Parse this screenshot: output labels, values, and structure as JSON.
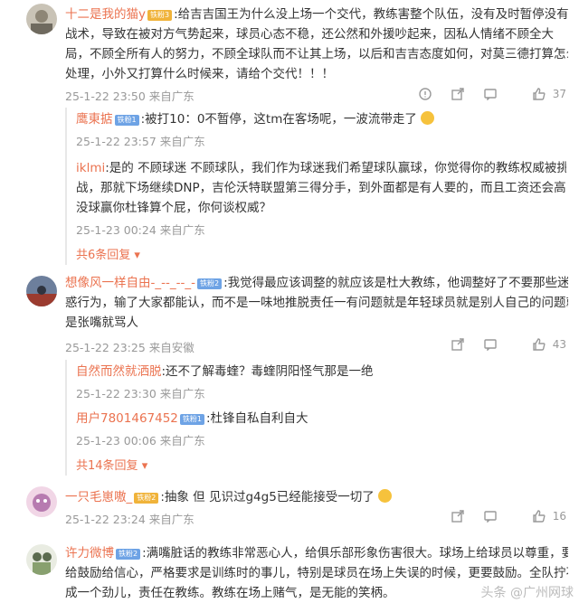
{
  "comments": [
    {
      "user": "十二是我的猫y",
      "badge": "铁粉3",
      "lines": [
        ":给吉吉国王为什么没上场一个交代，教练害整个队伍，没有及时暂停没有",
        "战术，导致在被对方气势起来，球员心态不稳，还公然和外援吵起来，因私人情绪不顾全大",
        "局，不顾全所有人的努力，不顾全球队而不让其上场，以后和吉吉态度如何，对莫三德打算怎么",
        "处理，小外又打算什么时候来，请给个交代！！！"
      ],
      "meta": "25-1-22 23:50 来自广东",
      "likes": "37",
      "replies": [
        {
          "user": "鹰東掂",
          "badge": "铁粉1",
          "text": ":被打10：0不暂停，这tm在客场呢，一波流带走了",
          "meta": "25-1-22 23:57 来自广东"
        },
        {
          "user": "iklmi",
          "lines": [
            ":是的 不顾球迷 不顾球队，我们作为球迷我们希望球队赢球，你觉得你的教练权威被挑",
            "战，那就下场继续DNP，吉伦沃特联盟第三得分手，到外面都是有人要的，而且工资还会高，",
            "没球赢你杜锋算个屁，你何谈权威？"
          ],
          "meta": "25-1-23 00:24 来自广东"
        }
      ],
      "more": "共6条回复"
    },
    {
      "user": "想像风一样自由-_--_--_-",
      "badge": "铁粉2",
      "lines": [
        ":我觉得最应该调整的就应该是杜大教练，他调整好了不要那些迷",
        "惑行为，输了大家都能认，而不是一味地推脱责任一有问题就是年轻球员就是别人自己的问题就",
        "是张嘴就骂人"
      ],
      "meta": "25-1-22 23:25 来自安徽",
      "likes": "43",
      "replies": [
        {
          "user": "自然而然就洒脱",
          "text": ":还不了解毒蝰？毒蝰阴阳怪气那是一绝",
          "meta": "25-1-22 23:30 来自广东"
        },
        {
          "user": "用户7801467452",
          "badge": "铁粉1",
          "text": ":杜锋自私自利自大",
          "meta": "25-1-23 00:06 来自广东"
        }
      ],
      "more": "共14条回复"
    },
    {
      "user": "一只毛崽嗷_",
      "badge": "铁粉2",
      "text": ":抽象 但 见识过g4g5已经能接受一切了",
      "meta": "25-1-22 23:24 来自广东",
      "likes": "16"
    },
    {
      "user": "许力微博",
      "badge": "铁粉2",
      "lines": [
        ":满嘴脏话的教练非常恶心人，给俱乐部形象伤害很大。球场上给球员以尊重，要",
        "给鼓励给信心，严格要求是训练时的事儿，特别是球员在场上失误的时候，更要鼓励。全队拧不",
        "成一个劲儿，责任在教练。教练在场上赌气，是无能的笑柄。"
      ]
    }
  ],
  "watermark": "头条 @广州网球"
}
